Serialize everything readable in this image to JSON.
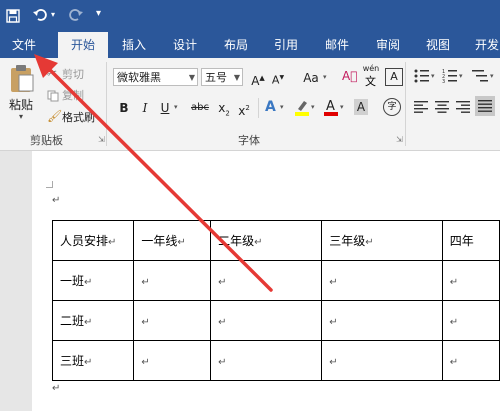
{
  "quick_access": {
    "save_icon": "save-icon",
    "undo_icon": "undo-icon",
    "redo_icon": "redo-icon"
  },
  "tabs": [
    "文件",
    "开始",
    "插入",
    "设计",
    "布局",
    "引用",
    "邮件",
    "审阅",
    "视图",
    "开发"
  ],
  "active_tab_index": 1,
  "ribbon": {
    "clipboard": {
      "paste_label": "粘贴",
      "cut_label": "剪切",
      "copy_label": "复制",
      "format_painter_label": "格式刷",
      "group_label": "剪贴板"
    },
    "font": {
      "font_name": "微软雅黑",
      "font_size": "五号",
      "grow_label": "A",
      "shrink_label": "A",
      "case_label": "Aa",
      "phonetic_label": "wén",
      "bold_label": "B",
      "italic_label": "I",
      "underline_label": "U",
      "strike_label": "abc",
      "subscript_label": "x",
      "superscript_label": "x",
      "group_label": "字体"
    }
  },
  "document": {
    "paragraph_mark": "↵",
    "table": {
      "headers": [
        "人员安排",
        "一年线",
        "二年级",
        "三年级",
        "四年"
      ],
      "rows": [
        [
          "一班",
          "",
          "",
          "",
          ""
        ],
        [
          "二班",
          "",
          "",
          "",
          ""
        ],
        [
          "三班",
          "",
          "",
          "",
          ""
        ]
      ]
    }
  },
  "colors": {
    "brand": "#2b579a",
    "arrow": "#e53935",
    "highlight": "#ffff00",
    "font_color_bar": "#e00000"
  }
}
